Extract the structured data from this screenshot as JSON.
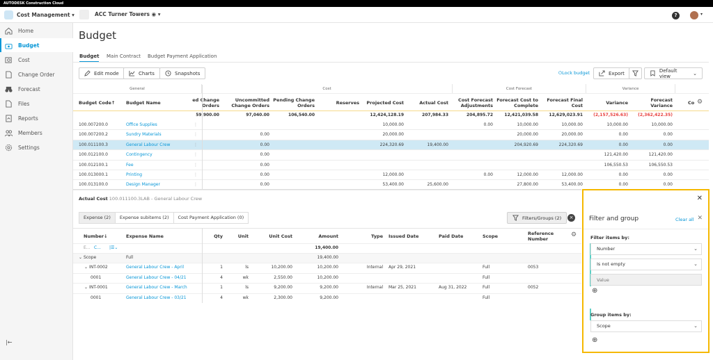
{
  "brand": "AUTODESK Construction Cloud",
  "app": {
    "name": "Cost Management",
    "project": "ACC Turner Towers"
  },
  "sidebar": {
    "items": [
      {
        "label": "Home"
      },
      {
        "label": "Budget"
      },
      {
        "label": "Cost"
      },
      {
        "label": "Change Order"
      },
      {
        "label": "Forecast"
      },
      {
        "label": "Files"
      },
      {
        "label": "Reports"
      },
      {
        "label": "Members"
      },
      {
        "label": "Settings"
      }
    ]
  },
  "page": {
    "title": "Budget",
    "tabs": [
      "Budget",
      "Main Contract",
      "Budget Payment Application"
    ]
  },
  "toolbar": {
    "edit": "Edit mode",
    "charts": "Charts",
    "snapshots": "Snapshots",
    "lock": "Lock budget",
    "export": "Export",
    "view": "Default view"
  },
  "help": "?",
  "budget": {
    "groups": [
      "General",
      "Cost",
      "Cost Forecast",
      "Variance"
    ],
    "columns": [
      "Budget Code",
      "Budget Name",
      "ed Change Orders",
      "Uncommitted Change Orders",
      "Pending Change Orders",
      "Reserves",
      "Projected Cost",
      "Actual Cost",
      "Cost Forecast Adjustments",
      "Forecast Cost to Complete",
      "Forecast Final Cost",
      "Variance",
      "Forecast Variance",
      "Co"
    ],
    "totals": [
      "",
      "",
      "59,900.00",
      "97,040.00",
      "106,540.00",
      "",
      "12,424,128.19",
      "207,984.33",
      "204,895.72",
      "12,421,039.58",
      "12,629,023.91",
      "(2,157,526.63)",
      "(2,362,422.35)"
    ],
    "rows": [
      [
        "100.007200.0",
        "Office Supplies",
        "",
        "",
        "",
        "",
        "10,000.00",
        "",
        "0.00",
        "10,000.00",
        "10,000.00",
        "10,000.00",
        "10,000.00"
      ],
      [
        "100.007200.2",
        "Sundry Materials",
        "",
        "0.00",
        "",
        "",
        "20,000.00",
        "",
        "",
        "20,000.00",
        "20,000.00",
        "0.00",
        "0.00"
      ],
      [
        "100.011100.3",
        "General Labour Crew",
        "",
        "0.00",
        "",
        "",
        "224,320.69",
        "19,400.00",
        "",
        "204,920.69",
        "224,320.69",
        "0.00",
        "0.00"
      ],
      [
        "100.012100.0",
        "Contingency",
        "",
        "0.00",
        "",
        "",
        "",
        "",
        "",
        "",
        "",
        "121,420.00",
        "121,420.00"
      ],
      [
        "100.012100.1",
        "Fee",
        "",
        "0.00",
        "",
        "",
        "",
        "",
        "",
        "",
        "",
        "106,550.53",
        "106,550.53"
      ],
      [
        "100.013000.1",
        "Printing",
        "",
        "0.00",
        "",
        "",
        "12,000.00",
        "",
        "0.00",
        "12,000.00",
        "12,000.00",
        "0.00",
        "0.00"
      ],
      [
        "100.013100.0",
        "Design Manager",
        "",
        "0.00",
        "",
        "",
        "53,400.00",
        "25,600.00",
        "",
        "27,800.00",
        "53,400.00",
        "0.00",
        "0.00"
      ]
    ],
    "selected_row": 2
  },
  "actual": {
    "label": "Actual Cost",
    "ref": "100.011100.3LAB - General Labour Crew",
    "tabs": [
      "Expense (2)",
      "Expense subitems (2)",
      "Cost Payment Application (0)"
    ],
    "filters_btn": "Filters/Groups (2)",
    "columns": [
      "Number",
      "Expense Name",
      "Qty",
      "Unit",
      "Unit Cost",
      "Amount",
      "Type",
      "Issued Date",
      "Paid Date",
      "Scope",
      "Reference Number"
    ],
    "filter_row": [
      "E...",
      "C...",
      "19,400.00"
    ],
    "group": {
      "label": "Scope",
      "value": "Full",
      "amount": "19,400.00"
    },
    "rows": [
      [
        "INT-0002",
        "General Labour Crew - April",
        "1",
        "ls",
        "10,200.00",
        "10,200.00",
        "Internal",
        "Apr 29, 2021",
        "",
        "Full",
        "0053"
      ],
      [
        "0001",
        "General Labour Crew - 04/21",
        "4",
        "wk",
        "2,550.00",
        "10,200.00",
        "",
        "",
        "",
        "Full",
        ""
      ],
      [
        "INT-0001",
        "General Labour Crew - March",
        "1",
        "ls",
        "9,200.00",
        "9,200.00",
        "Internal",
        "Mar 25, 2021",
        "Aug 31, 2022",
        "Full",
        "0052"
      ],
      [
        "0001",
        "General Labour Crew - 03/21",
        "4",
        "wk",
        "2,300.00",
        "9,200.00",
        "",
        "",
        "",
        "Full",
        ""
      ]
    ]
  },
  "panel": {
    "title": "Filter and group",
    "clear": "Clear all",
    "filter_label": "Filter items by:",
    "field": "Number",
    "operator": "Is not empty",
    "value_placeholder": "Value",
    "group_label": "Group items by:",
    "group_field": "Scope"
  },
  "colors": {
    "accent": "#0696d7",
    "highlight": "#f5b800",
    "selected": "#cfe9f5",
    "negative": "#e8423f"
  }
}
